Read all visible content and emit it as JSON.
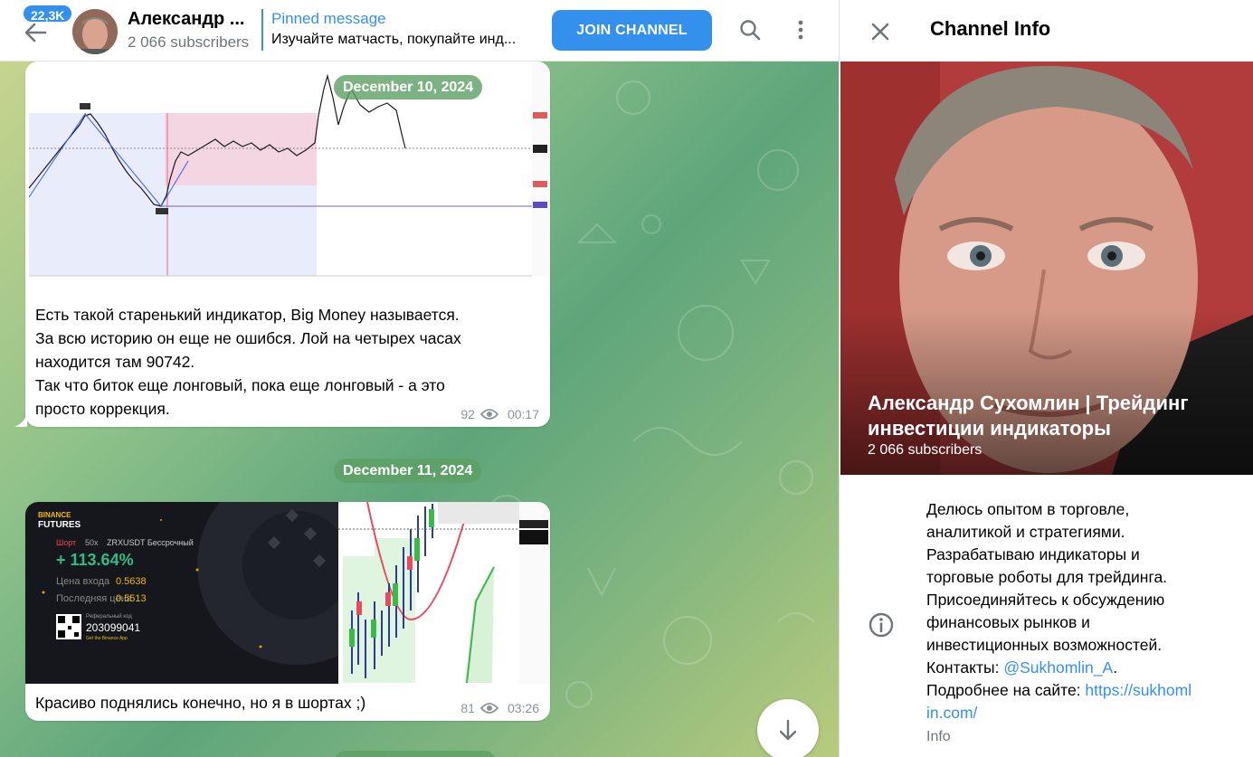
{
  "header": {
    "unread_count": "22,3K",
    "channel_title": "Александр ...",
    "subscribers": "2 066 subscribers",
    "pinned_label": "Pinned message",
    "pinned_text": "Изучайте матчасть, покупайте инд...",
    "join_label": "JOIN CHANNEL"
  },
  "messages": [
    {
      "date": "December 10, 2024",
      "lines": [
        "Есть такой старенький индикатор, Big Money называется.",
        "За всю историю он еще не ошибся. Лой на четырех часах",
        "находится там 90742.",
        "Так что биток еще лонговый, пока еще лонговый - а это",
        "просто коррекция."
      ],
      "views": "92",
      "time": "00:17"
    },
    {
      "date": "December 11, 2024",
      "lines": [
        "Красиво поднялись конечно, но я в шортах ;)"
      ],
      "views": "81",
      "time": "03:26",
      "card": {
        "brand": "BINANCE",
        "product": "FUTURES",
        "side": "Шорт",
        "leverage": "50x",
        "pair": "ZRXUSDT Бессрочный",
        "pnl": "+ 113.64%",
        "entry_label": "Цена входа",
        "entry_value": "0.5638",
        "last_label": "Последняя цена",
        "last_value": "0.5513",
        "ref_label": "Реферальный код",
        "ref_code": "203099041",
        "app_note": "Get the Binance App"
      }
    }
  ],
  "info": {
    "title": "Channel Info",
    "name": "Александр Сухомлин | Трейдинг инвестиции индикаторы",
    "subscribers": "2 066 subscribers",
    "desc_lines": [
      "Делюсь опытом в торговле,",
      "аналитикой и стратегиями.",
      "Разрабатываю индикаторы и",
      "торговые роботы для трейдинга.",
      "Присоединяйтесь к обсуждению",
      "финансовых рынков и",
      "инвестиционных возможностей."
    ],
    "contacts_label": "Контакты: ",
    "contacts_handle": "@Sukhomlin_A",
    "contacts_suffix": ".",
    "site_label": "Подробнее на сайте: ",
    "site_link_1": "https://sukhoml",
    "site_link_2": "in.com/",
    "section_label": "Info"
  },
  "colors": {
    "accent": "#3390ec",
    "date_pill": "#5ca064",
    "profit": "#2ebd85"
  }
}
